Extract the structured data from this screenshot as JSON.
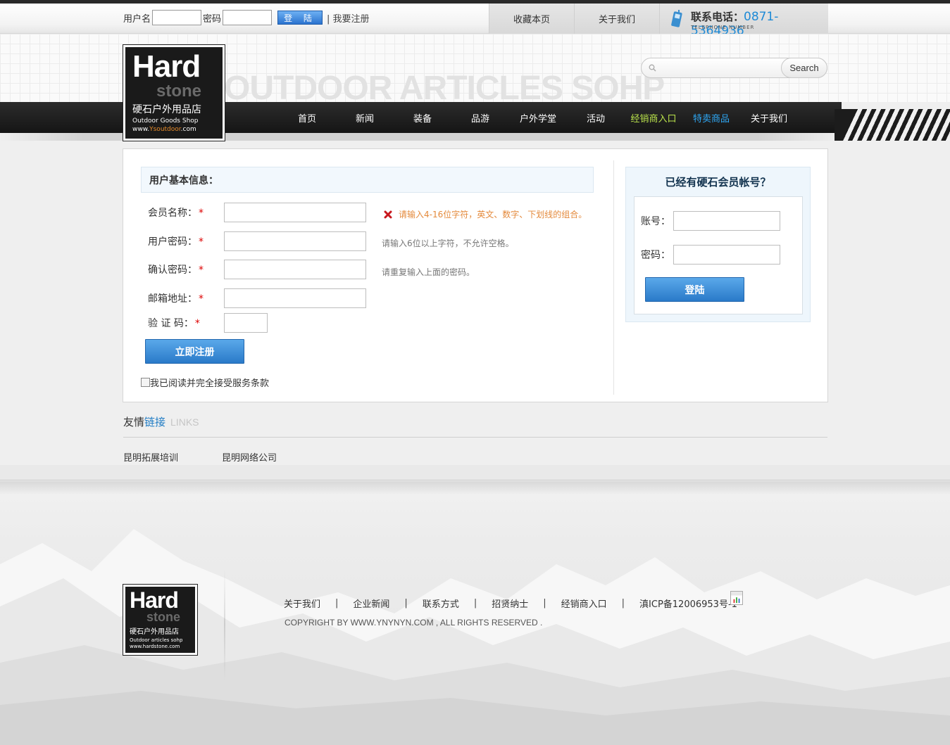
{
  "topbar": {
    "username_label": "用户名",
    "password_label": "密码",
    "login_btn": "登 陆",
    "register_link": "| 我要注册",
    "bookmark": "收藏本页",
    "about": "关于我们",
    "phone_label": "联系电话：",
    "phone_number": "0871-5364936",
    "phone_sub": "TELEPHONE NUMBER"
  },
  "header": {
    "bg_text": "OUTDOOR ARTICLES SOHP",
    "search_placeholder": "",
    "search_btn": "Search"
  },
  "logo": {
    "word": "Hard",
    "stone": "stone",
    "cn": "硬石户外用品店",
    "en": "Outdoor Goods Shop",
    "url_pre": "www.",
    "url_brand": "Ysoutdoor",
    "url_post": ".com"
  },
  "nav": [
    {
      "label": "首页",
      "style": "normal"
    },
    {
      "label": "新闻",
      "style": "normal"
    },
    {
      "label": "装备",
      "style": "normal"
    },
    {
      "label": "品游",
      "style": "normal"
    },
    {
      "label": "户外学堂",
      "style": "normal"
    },
    {
      "label": "活动",
      "style": "normal"
    },
    {
      "label": "经销商入口",
      "style": "green"
    },
    {
      "label": "特卖商品",
      "style": "blue"
    },
    {
      "label": "关于我们",
      "style": "normal"
    }
  ],
  "register": {
    "section_title": "用户基本信息：",
    "fields": {
      "member": {
        "label": "会员名称：",
        "hint": "请输入4-16位字符，英文、数字、下划线的组合。"
      },
      "password": {
        "label": "用户密码：",
        "hint": "请输入6位以上字符，不允许空格。"
      },
      "confirm": {
        "label": "确认密码：",
        "hint": "请重复输入上面的密码。"
      },
      "email": {
        "label": "邮箱地址："
      },
      "captcha": {
        "label": "验 证 码："
      }
    },
    "required_mark": "*",
    "submit": "立即注册",
    "agree": "我已阅读并完全接受服务条款"
  },
  "side_login": {
    "title": "已经有硬石会员帐号？",
    "account_label": "账号：",
    "password_label": "密码：",
    "login_btn": "登陆"
  },
  "links": {
    "title_a": "友情",
    "title_b": "链接",
    "title_en": "LINKS",
    "items": [
      "昆明拓展培训",
      "昆明网络公司"
    ]
  },
  "footer": {
    "logo_word": "Hard",
    "logo_stone": "stone",
    "logo_cn": "硬石户外用品店",
    "logo_en": "Outdoor articles sohp",
    "logo_url": "www.hardstone.com",
    "links": [
      "关于我们",
      "企业新闻",
      "联系方式",
      "招贤纳士",
      "经销商入口",
      "滇ICP备12006953号-1"
    ],
    "separator": "|",
    "copyright": "COPYRIGHT BY WWW.YNYNYN.COM , ALL RIGHTS RESERVED ."
  },
  "colors": {
    "accent_blue": "#1e8ad6",
    "nav_green": "#b9e24b",
    "nav_blue": "#2ea8f5",
    "error_orange": "#e48a3c"
  }
}
